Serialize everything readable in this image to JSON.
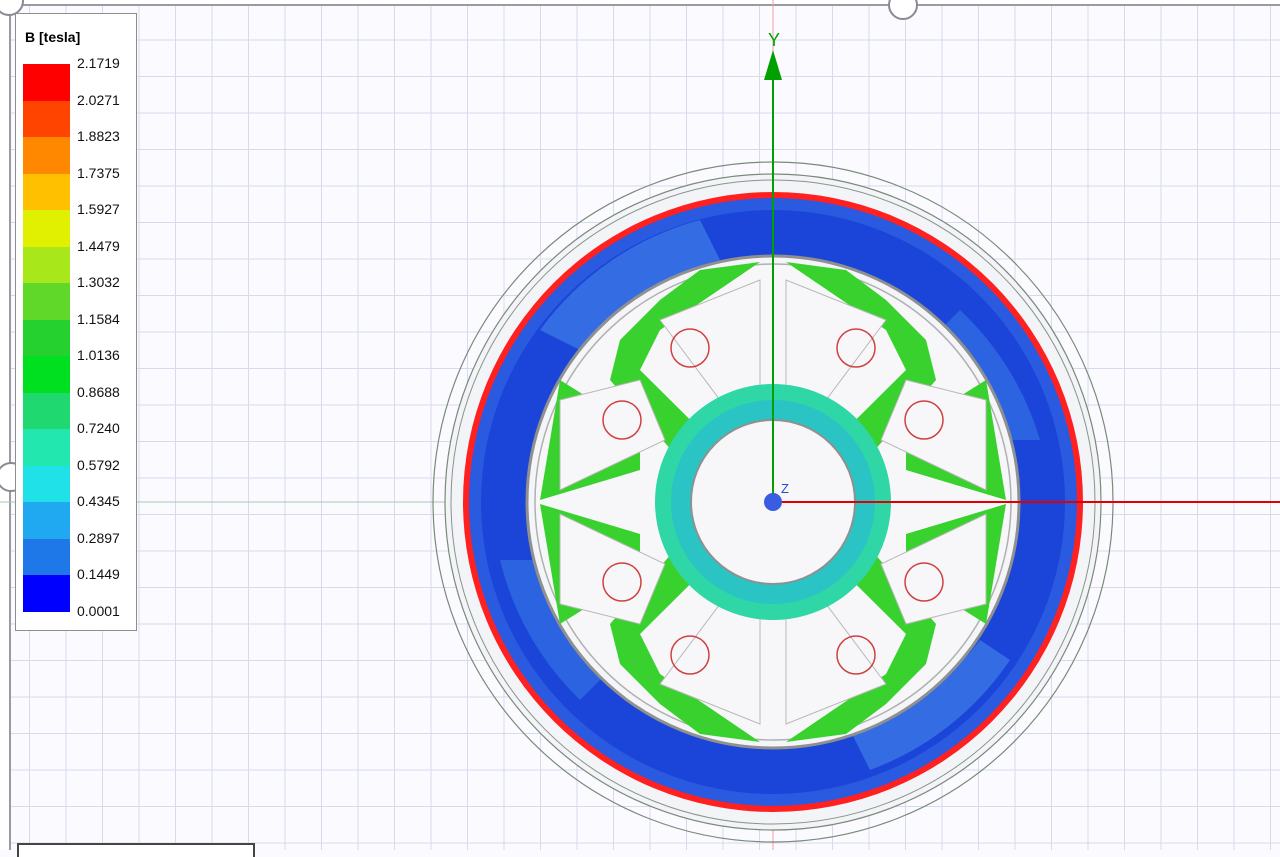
{
  "legend": {
    "title": "B [tesla]",
    "levels": [
      "2.1719",
      "2.0271",
      "1.8823",
      "1.7375",
      "1.5927",
      "1.4479",
      "1.3032",
      "1.1584",
      "1.0136",
      "0.8688",
      "0.7240",
      "0.5792",
      "0.4345",
      "0.2897",
      "0.1449",
      "0.0001"
    ],
    "colors": [
      "#ff0000",
      "#ff4400",
      "#ff8800",
      "#ffc000",
      "#e0f000",
      "#a8e81a",
      "#60d82a",
      "#25d12e",
      "#00e020",
      "#20d870",
      "#22e8b0",
      "#20e0e8",
      "#20a8f0",
      "#1e78e8",
      "#1448e6",
      "#0000ff"
    ]
  },
  "axes": {
    "y_label": "Y",
    "z_label": "Z",
    "x_color": "#e00000",
    "y_color": "#00a000"
  },
  "colors": {
    "stator_high": "#ff2020",
    "stator_body": "#1a45d8",
    "rotor_body": "#39d12e",
    "shaft_ring": "#2fd6a6",
    "conductor": "#d04040"
  }
}
